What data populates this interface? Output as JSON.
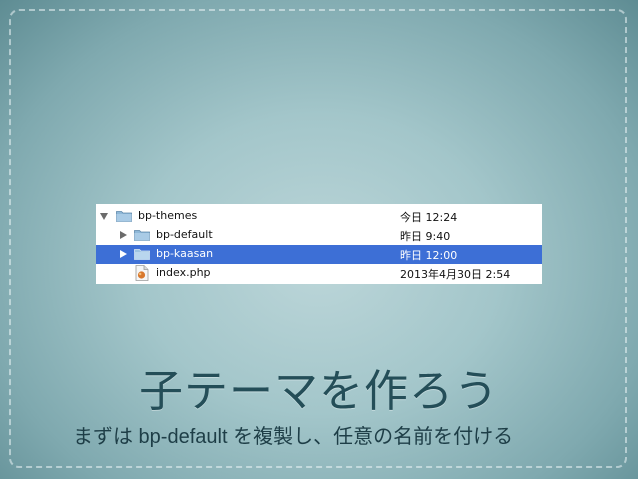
{
  "finder": {
    "rows": [
      {
        "name": "bp-themes",
        "date": "今日 12:24",
        "expanded": true,
        "selected": false
      },
      {
        "name": "bp-default",
        "date": "昨日 9:40",
        "expanded": false,
        "selected": false
      },
      {
        "name": "bp-kaasan",
        "date": "昨日 12:00",
        "expanded": false,
        "selected": true
      },
      {
        "name": "index.php",
        "date": "2013年4月30日 2:54",
        "selected": false
      }
    ],
    "colors": {
      "selection": "#3d6fd6",
      "folder": "#8fb8d8"
    }
  },
  "slide": {
    "title": "子テーマを作ろう",
    "subtitle": "まずは bp-default を複製し、任意の名前を付ける"
  }
}
